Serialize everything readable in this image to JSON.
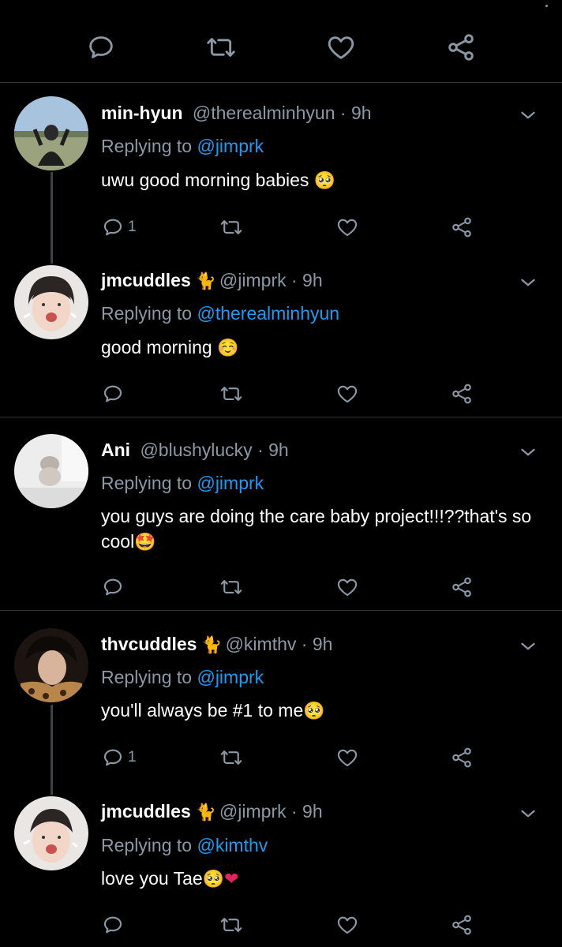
{
  "tweets": [
    {
      "name": "min-hyun",
      "badge": "",
      "handle": "@therealminhyun",
      "time": " · 9h",
      "replying_prefix": "Replying to ",
      "replying_to": "@jimprk",
      "text": "uwu good morning babies ",
      "emoji": "🥺",
      "reply_count": "1"
    },
    {
      "name": "jmcuddles",
      "badge": "🐈",
      "handle": "@jimprk",
      "time": " · 9h",
      "replying_prefix": "Replying to ",
      "replying_to": "@therealminhyun",
      "text": "good morning ",
      "emoji": "☺️",
      "reply_count": ""
    },
    {
      "name": "Ani",
      "badge": "",
      "handle": "@blushylucky",
      "time": " · 9h",
      "replying_prefix": "Replying to ",
      "replying_to": "@jimprk",
      "text": "you guys are doing the care baby project!!!??that's so cool",
      "emoji": "🤩",
      "reply_count": ""
    },
    {
      "name": "thvcuddles",
      "badge": "🐈",
      "handle": "@kimthv",
      "time": " · 9h",
      "replying_prefix": "Replying to ",
      "replying_to": "@jimprk",
      "text": "you'll always be #1 to me",
      "emoji": "🥺",
      "reply_count": "1"
    },
    {
      "name": "jmcuddles",
      "badge": "🐈",
      "handle": "@jimprk",
      "time": " · 9h",
      "replying_prefix": "Replying to ",
      "replying_to": "@kimthv",
      "text": "love you Tae",
      "emoji": "🥺",
      "emoji2": "❤",
      "reply_count": ""
    }
  ],
  "colors": {
    "background": "#000000",
    "link": "#1d9bf0",
    "muted": "#8b98a5",
    "heart": "#e0245e"
  },
  "icons": [
    "reply-icon",
    "retweet-icon",
    "like-icon",
    "share-icon",
    "chevron-down-icon"
  ]
}
